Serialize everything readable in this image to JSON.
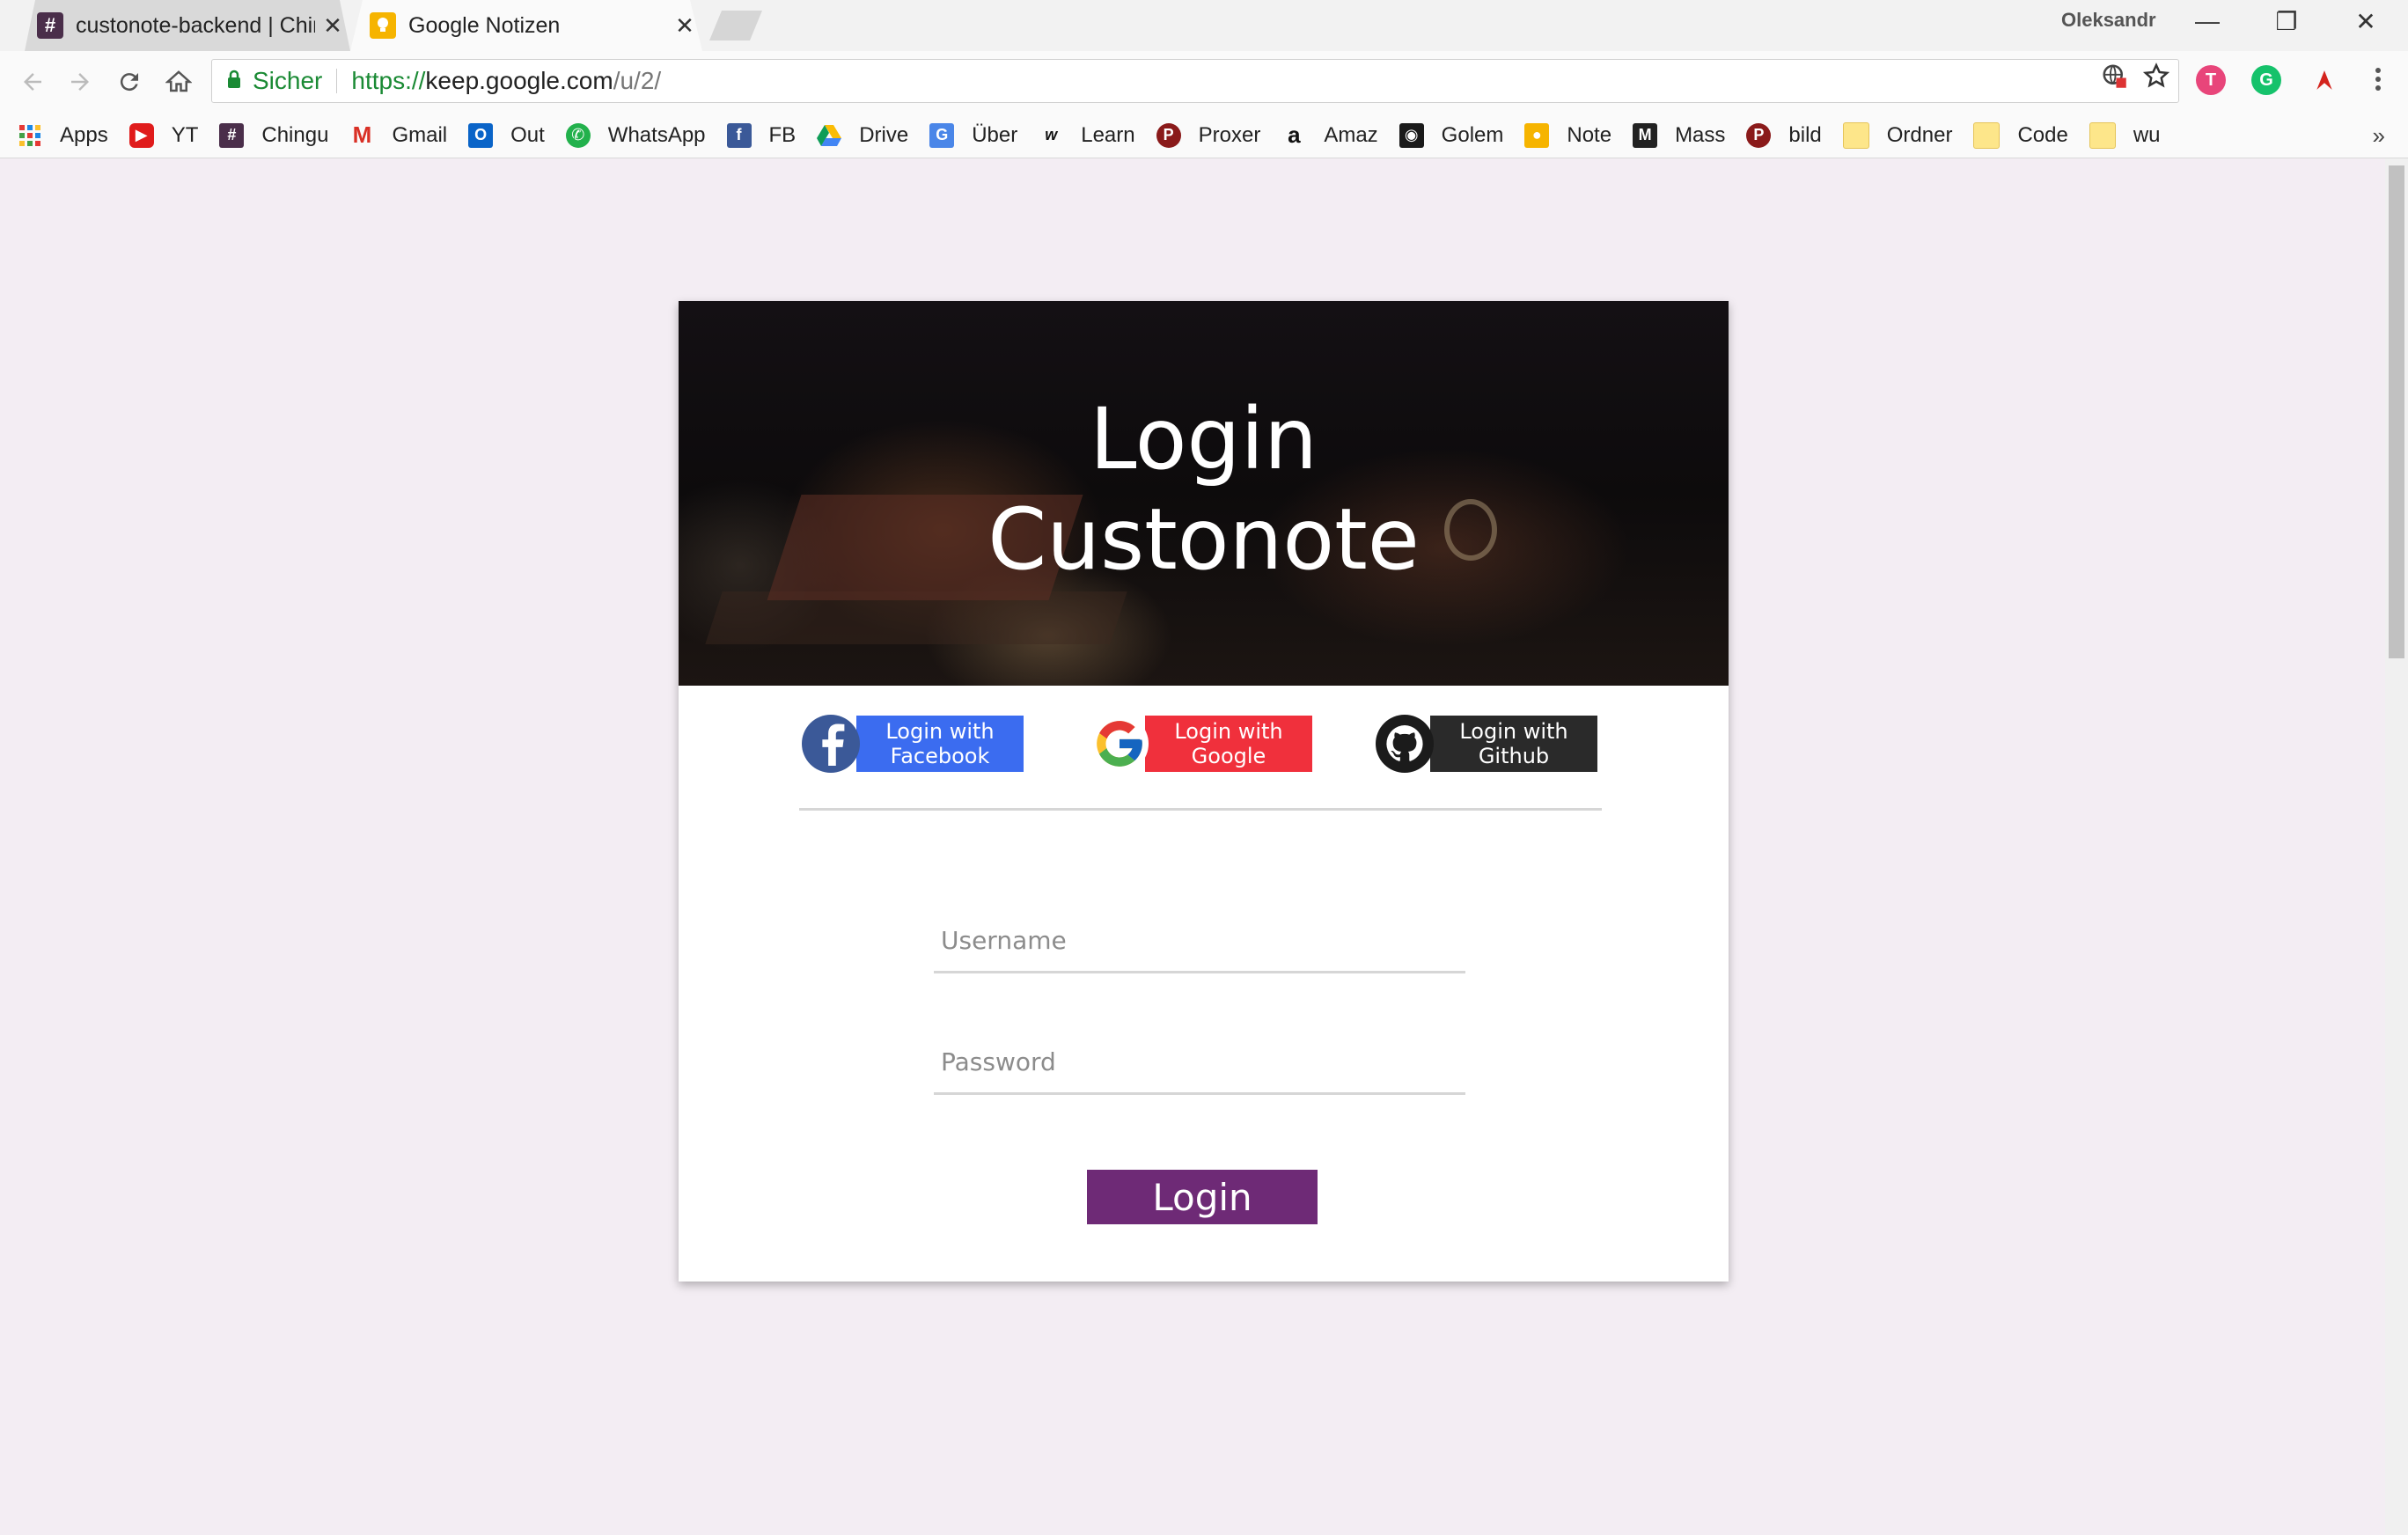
{
  "browser": {
    "tabs": [
      {
        "title": "custonote-backend | Chir",
        "favicon": "hash-icon",
        "active": false
      },
      {
        "title": "Google Notizen",
        "favicon": "keep-bulb-icon",
        "active": true
      }
    ],
    "profile_name": "Oleksandr",
    "omnibox": {
      "secure_label": "Sicher",
      "url_scheme": "https://",
      "url_host": "keep.google.com",
      "url_path": "/u/2/"
    },
    "bookmarks": [
      {
        "label": "Apps",
        "icon": "apps-grid-icon"
      },
      {
        "label": "YT",
        "icon": "youtube-icon"
      },
      {
        "label": "Chingu",
        "icon": "hash-icon"
      },
      {
        "label": "Gmail",
        "icon": "gmail-icon"
      },
      {
        "label": "Out",
        "icon": "outlook-icon"
      },
      {
        "label": "WhatsApp",
        "icon": "whatsapp-icon"
      },
      {
        "label": "FB",
        "icon": "facebook-icon"
      },
      {
        "label": "Drive",
        "icon": "drive-icon"
      },
      {
        "label": "Über",
        "icon": "translate-icon"
      },
      {
        "label": "Learn",
        "icon": "w-icon"
      },
      {
        "label": "Proxer",
        "icon": "proxer-icon"
      },
      {
        "label": "Amaz",
        "icon": "amazon-icon"
      },
      {
        "label": "Golem",
        "icon": "golem-icon"
      },
      {
        "label": "Note",
        "icon": "keep-bulb-icon"
      },
      {
        "label": "Mass",
        "icon": "mass-icon"
      },
      {
        "label": "bild",
        "icon": "proxer-icon"
      },
      {
        "label": "Ordner",
        "icon": "folder-icon"
      },
      {
        "label": "Code",
        "icon": "folder-icon"
      },
      {
        "label": "wu",
        "icon": "folder-icon"
      }
    ],
    "overflow_label": "»"
  },
  "login": {
    "title_line1": "Login",
    "title_line2": "Custonote",
    "social": [
      {
        "label": "Login with\nFacebook",
        "icon": "facebook-icon",
        "color": "#3b6cf0"
      },
      {
        "label": "Login with\nGoogle",
        "icon": "google-icon",
        "color": "#f0303c"
      },
      {
        "label": "Login with\nGithub",
        "icon": "github-icon",
        "color": "#2a2a2a"
      }
    ],
    "username_placeholder": "Username",
    "password_placeholder": "Password",
    "submit_label": "Login",
    "accent_color": "#6e2a76"
  },
  "colors": {
    "page_background": "#f3edf3",
    "secure_green": "#1a8a34"
  }
}
